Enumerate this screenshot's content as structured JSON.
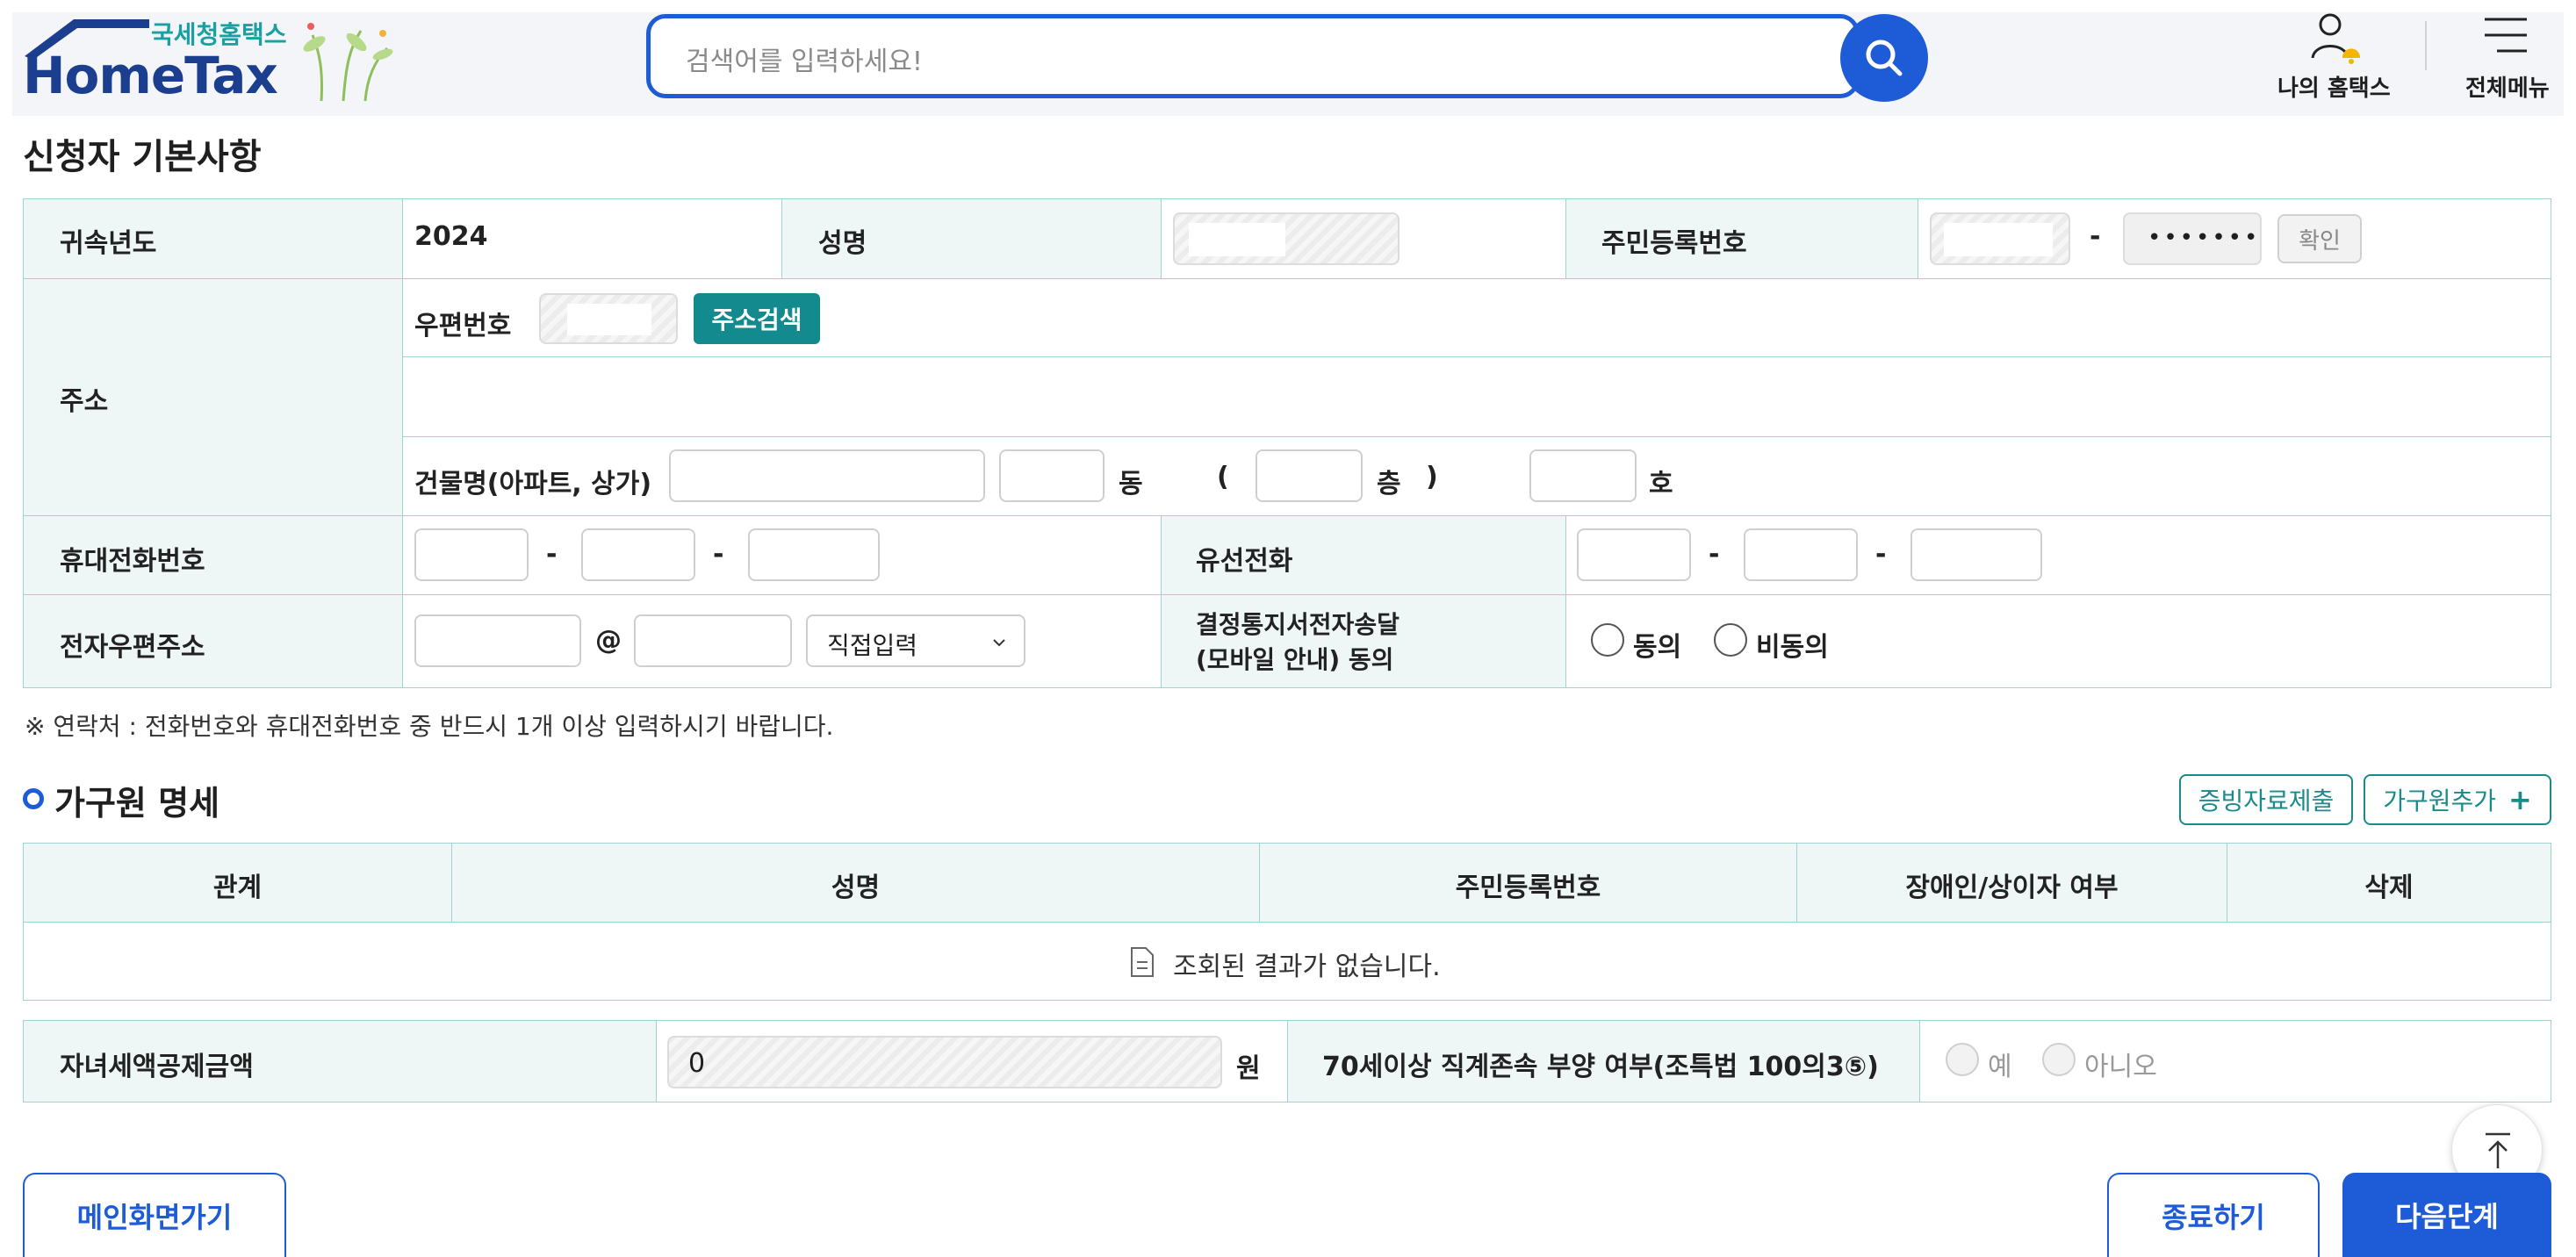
{
  "header": {
    "logo_text": "HomeTax",
    "logo_sub": "국세청홈택스",
    "search_placeholder": "검색어를 입력하세요!",
    "my_hometax": "나의 홈택스",
    "all_menu": "전체메뉴"
  },
  "applicant": {
    "section_title": "신청자 기본사항",
    "year_label": "귀속년도",
    "year_value": "2024",
    "name_label": "성명",
    "rrn_label": "주민등록번호",
    "rrn_dash": "-",
    "rrn_masked": "•••••••",
    "confirm_button": "확인",
    "address_label": "주소",
    "postal_label": "우편번호",
    "address_search_button": "주소검색",
    "building_label": "건물명(아파트, 상가)",
    "dong_label": "동",
    "paren_open": "(",
    "floor_label": "층",
    "paren_close": ")",
    "ho_label": "호",
    "mobile_label": "휴대전화번호",
    "phone_dash": "-",
    "landline_label": "유선전화",
    "email_label": "전자우편주소",
    "email_at": "@",
    "email_domain_select": "직접입력",
    "consent_label_line1": "결정통지서전자송달",
    "consent_label_line2": "(모바일 안내) 동의",
    "consent_agree": "동의",
    "consent_disagree": "비동의",
    "notice": "※ 연락처 : 전화번호와 휴대전화번호 중 반드시 1개 이상 입력하시기 바랍니다."
  },
  "household": {
    "section_title": "가구원 명세",
    "submit_docs_button": "증빙자료제출",
    "add_member_button": "가구원추가",
    "add_icon_glyph": "+",
    "columns": [
      "관계",
      "성명",
      "주민등록번호",
      "장애인/상이자 여부",
      "삭제"
    ],
    "empty_message": "조회된 결과가 없습니다."
  },
  "deduction": {
    "child_credit_label": "자녀세액공제금액",
    "child_credit_value": "0",
    "currency_unit": "원",
    "elderly_label": "70세이상 직계존속 부양 여부(조특법 100의3⑤)",
    "yes_label": "예",
    "no_label": "아니오"
  },
  "footer": {
    "main_button": "메인화면가기",
    "exit_button": "종료하기",
    "next_button": "다음단계"
  },
  "colors": {
    "brand_blue": "#1e5bd6",
    "teal": "#1a8a8a",
    "cell_bg": "#eef7f6",
    "border": "#9fd3d1"
  }
}
